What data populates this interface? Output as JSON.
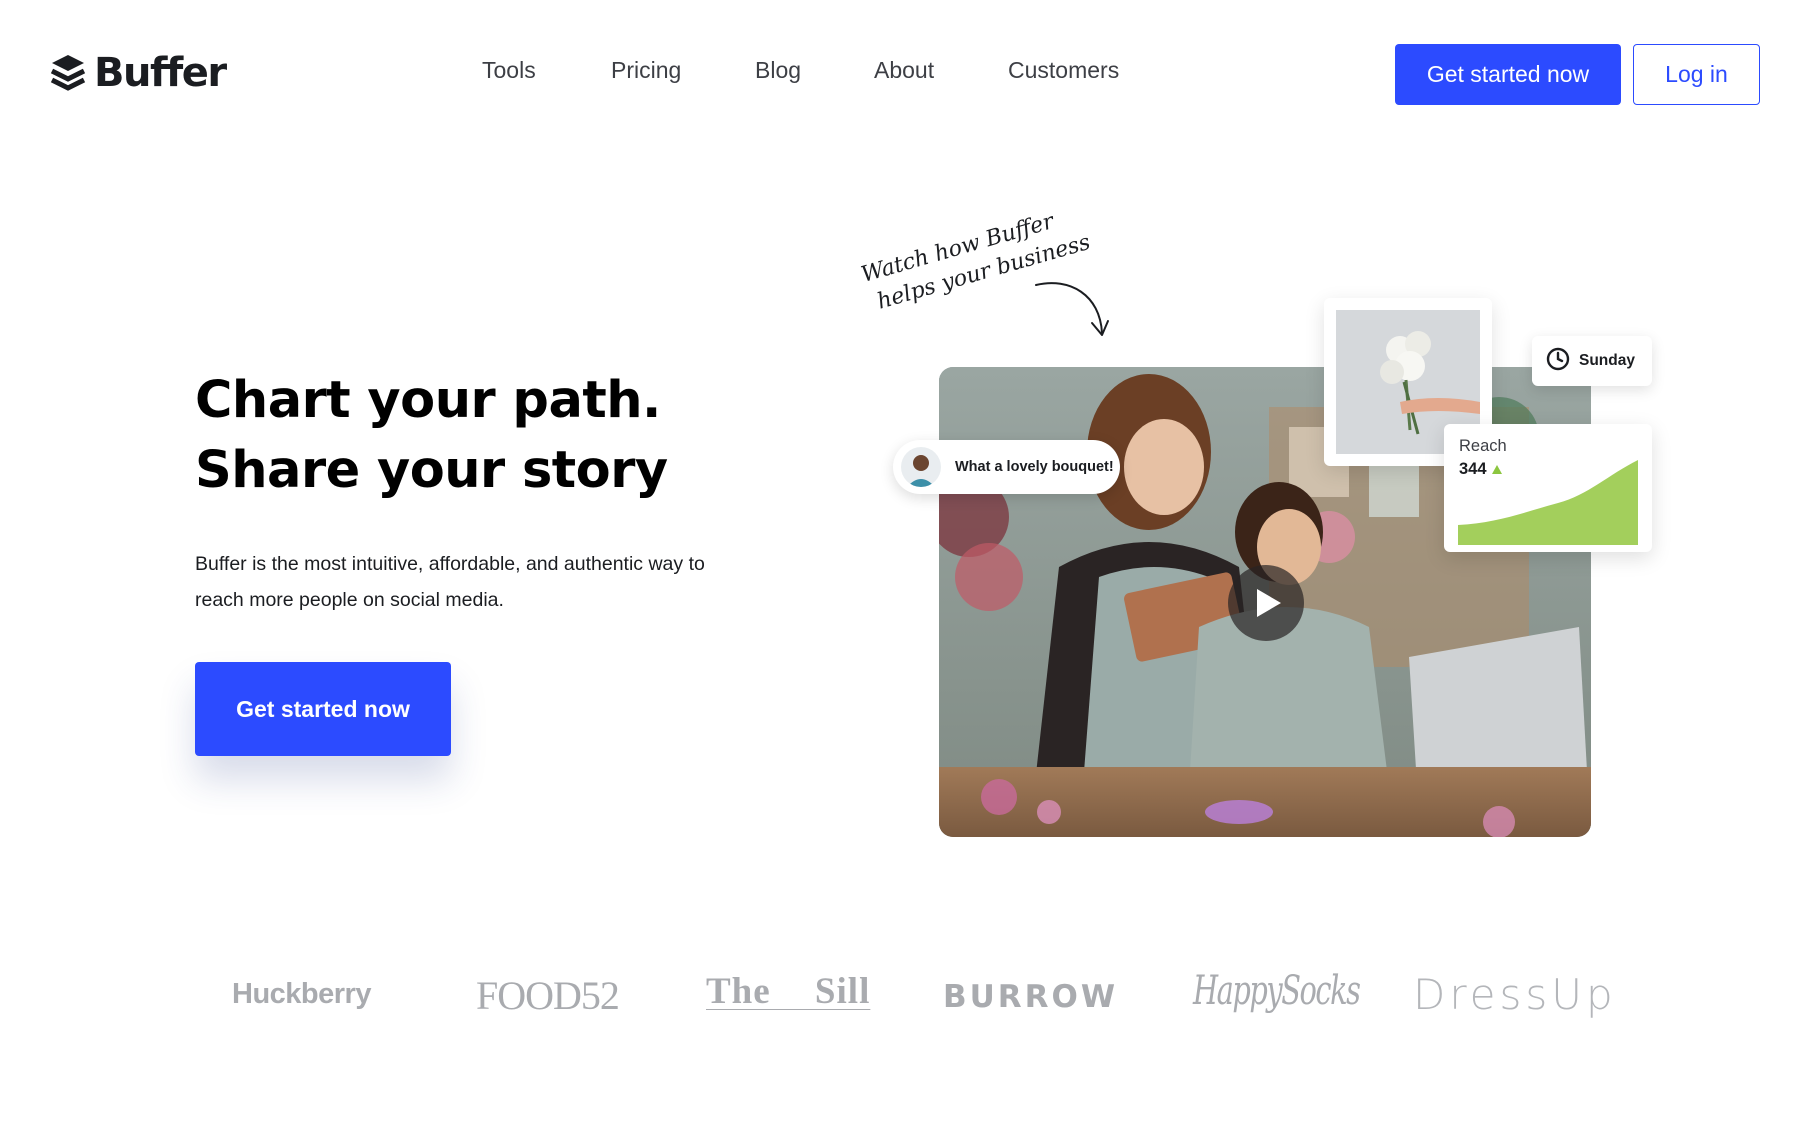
{
  "header": {
    "logo_text": "Buffer",
    "logo_icon": "buffer-stack-icon",
    "nav": [
      {
        "label": "Tools"
      },
      {
        "label": "Pricing"
      },
      {
        "label": "Blog"
      },
      {
        "label": "About"
      },
      {
        "label": "Customers"
      }
    ],
    "cta_label": "Get started now",
    "login_label": "Log in"
  },
  "hero": {
    "title_line1": "Chart your path.",
    "title_line2": "Share your story",
    "subtitle": "Buffer is the most intuitive, affordable, and authentic way to reach more people on social media.",
    "cta_label": "Get started now"
  },
  "visual": {
    "handnote_line1": "Watch how Buffer",
    "handnote_line2": "helps your business",
    "comment_text": "What a lovely bouquet!",
    "schedule_day": "Sunday",
    "reach_label": "Reach",
    "reach_value": "344",
    "trend": "up",
    "icons": [
      "curved-arrow-icon",
      "play-icon",
      "clock-icon",
      "trend-up-icon"
    ]
  },
  "customers": [
    {
      "name": "Huckberry"
    },
    {
      "name": "FOOD52"
    },
    {
      "name": "The Sill"
    },
    {
      "name": "BURROW"
    },
    {
      "name": "HappySocks"
    },
    {
      "name": "DressUp"
    }
  ],
  "colors": {
    "accent": "#2c4bff",
    "text": "#1b1d21",
    "muted_logo": "#a9abaf",
    "chart_green": "#a3cf5c"
  }
}
